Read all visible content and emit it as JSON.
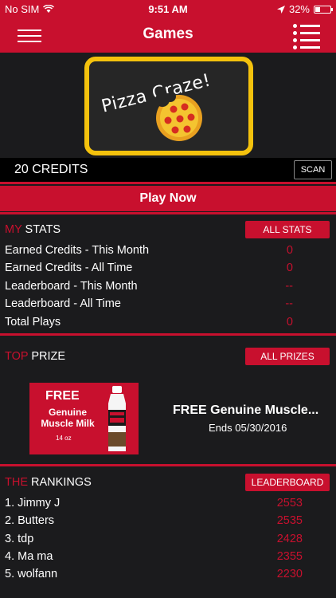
{
  "status_bar": {
    "carrier": "No SIM",
    "time": "9:51 AM",
    "battery": "32%"
  },
  "nav": {
    "title": "Games"
  },
  "banner": {
    "logo_text": "Pizza Craze!"
  },
  "credits": {
    "label": "20 CREDITS",
    "scan_label": "SCAN"
  },
  "play_now": "Play Now",
  "my_stats": {
    "title_accent": "MY",
    "title_rest": "STATS",
    "button": "ALL STATS",
    "rows": [
      {
        "label": "Earned Credits - This Month",
        "value": "0"
      },
      {
        "label": "Earned Credits - All Time",
        "value": "0"
      },
      {
        "label": "Leaderboard - This Month",
        "value": "--"
      },
      {
        "label": "Leaderboard - All Time",
        "value": "--"
      },
      {
        "label": "Total Plays",
        "value": "0"
      }
    ]
  },
  "top_prize": {
    "title_accent": "TOP",
    "title_rest": "PRIZE",
    "button": "ALL PRIZES",
    "image_line1": "FREE",
    "image_line2": "Genuine Muscle Milk",
    "image_line3": "14 oz",
    "name": "FREE Genuine Muscle...",
    "ends": "Ends 05/30/2016"
  },
  "rankings": {
    "title_accent": "THE",
    "title_rest": "RANKINGS",
    "button": "LEADERBOARD",
    "rows": [
      {
        "name": "1. Jimmy J",
        "score": "2553"
      },
      {
        "name": "2. Butters",
        "score": "2535"
      },
      {
        "name": "3. tdp",
        "score": "2428"
      },
      {
        "name": "4. Ma ma",
        "score": "2355"
      },
      {
        "name": "5. wolfann",
        "score": "2230"
      }
    ]
  },
  "colors": {
    "accent": "#c8102e",
    "background": "#1b1b1d",
    "logo_border": "#f4c20d"
  }
}
